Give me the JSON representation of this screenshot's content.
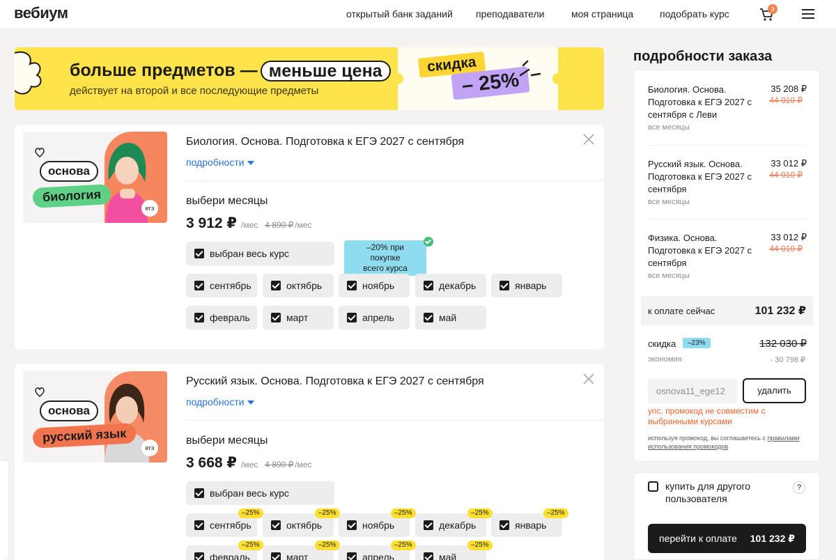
{
  "header": {
    "logo": "вебиум",
    "nav": [
      "открытый банк заданий",
      "преподаватели",
      "моя страница",
      "подобрать курс"
    ],
    "cart_count": "3"
  },
  "banner": {
    "title_part1": "больше предметов —",
    "title_part2": "меньше цена",
    "subtitle": "действует на второй и все последующие предметы",
    "sale_word": "скидка",
    "sale_value": "– 25%"
  },
  "courses": [
    {
      "img_osnova": "основа",
      "img_subject": "биология",
      "img_ege": "егэ",
      "title": "Биология. Основа. Подготовка к ЕГЭ 2027 с сентября",
      "details": "подробности",
      "choose_label": "выбери месяцы",
      "price_now": "3 912 ₽",
      "price_unit": "/мес",
      "price_old": "4 890 ₽",
      "price_old_unit": "/мес",
      "all_course": "выбран весь курс",
      "promo_line1": "–20% при покупке",
      "promo_line2": "всего курса",
      "months": [
        "сентябрь",
        "октябрь",
        "ноябрь",
        "декабрь",
        "январь",
        "февраль",
        "март",
        "апрель",
        "май"
      ]
    },
    {
      "img_osnova": "основа",
      "img_subject": "русский язык",
      "img_ege": "егэ",
      "title": "Русский язык. Основа. Подготовка к ЕГЭ 2027 с сентября",
      "details": "подробности",
      "choose_label": "выбери месяцы",
      "price_now": "3 668 ₽",
      "price_unit": "/мес",
      "price_old": "4 890 ₽",
      "price_old_unit": "/мес",
      "all_course": "выбран весь курс",
      "month_badge": "–25%",
      "months": [
        "сентябрь",
        "октябрь",
        "ноябрь",
        "декабрь",
        "январь",
        "февраль",
        "март",
        "апрель",
        "май"
      ]
    }
  ],
  "order": {
    "heading": "подробности заказа",
    "items": [
      {
        "name": "Биология. Основа. Подготовка к ЕГЭ 2027 с сентября с Леви",
        "price": "35 208 ₽",
        "old": "44 010 ₽",
        "months": "все месяцы"
      },
      {
        "name": "Русский язык. Основа. Подготовка к ЕГЭ 2027 с сентября",
        "price": "33 012 ₽",
        "old": "44 010 ₽",
        "months": "все месяцы"
      },
      {
        "name": "Физика. Основа. Подготовка к ЕГЭ 2027 с сентября",
        "price": "33 012 ₽",
        "old": "44 010 ₽",
        "months": "все месяцы"
      }
    ],
    "pay_now_label": "к оплате сейчас",
    "pay_now_value": "101 232 ₽",
    "discount_label": "скидка",
    "discount_tag": "–23%",
    "discount_old": "132 030 ₽",
    "economy_label": "экономия",
    "economy_value": "- 30 798 ₽",
    "promo_code": "osnova11_ege12",
    "promo_delete": "удалить",
    "promo_error": "упс, промокод не совместим с выбранными курсами",
    "promo_note_text": "используя промокод, вы соглашаетесь с",
    "promo_note_link": "правилами использования промокодов"
  },
  "gift": {
    "label": "купить для другого пользователя",
    "help": "?"
  },
  "checkout": {
    "label": "перейти к оплате",
    "amount": "101 232 ₽"
  },
  "colors": {
    "banner_yellow": "#ffe34a",
    "accent_orange": "#f27b54",
    "link_blue": "#2774d9",
    "promo_blue": "#8fdcf1",
    "sale_purple": "#c2a4f7",
    "error_orange": "#f2622a"
  }
}
